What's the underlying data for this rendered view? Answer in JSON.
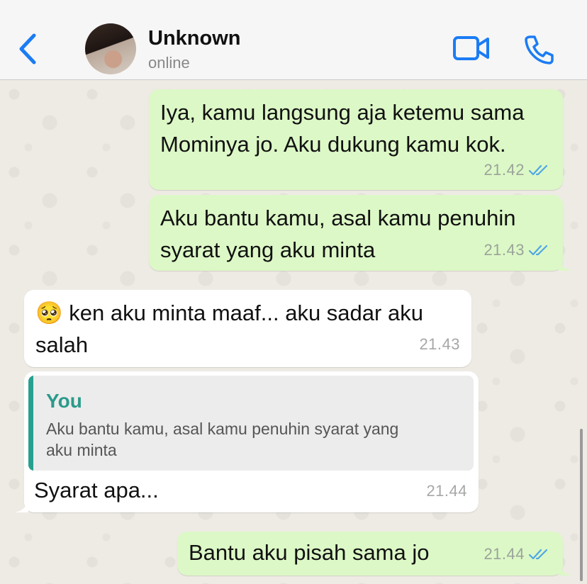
{
  "header": {
    "contact_name": "Unknown",
    "contact_status": "online",
    "back_icon": "chevron-left-icon",
    "video_icon": "video-camera-icon",
    "call_icon": "phone-icon",
    "accent_color": "#1b7cf4"
  },
  "messages": [
    {
      "direction": "outgoing",
      "lines": [
        "Iya, kamu langsung aja ketemu sama",
        "Mominya jo. Aku dukung kamu kok."
      ],
      "time": "21.42",
      "status": "read"
    },
    {
      "direction": "outgoing",
      "lines": [
        "Aku bantu kamu, asal kamu penuhin",
        "syarat yang aku minta"
      ],
      "time": "21.43",
      "status": "read"
    },
    {
      "direction": "incoming",
      "emoji": "🥺",
      "lines": [
        "ken aku minta maaf... aku sadar aku",
        "salah"
      ],
      "time": "21.43"
    },
    {
      "direction": "incoming",
      "quote": {
        "author": "You",
        "lines": [
          "Aku bantu kamu, asal kamu penuhin syarat yang",
          "aku minta"
        ]
      },
      "lines": [
        "Syarat apa..."
      ],
      "time": "21.44"
    },
    {
      "direction": "outgoing",
      "lines": [
        "Bantu aku pisah sama jo"
      ],
      "time": "21.44",
      "status": "read"
    }
  ],
  "colors": {
    "outgoing_bubble": "#dcf8c6",
    "incoming_bubble": "#ffffff",
    "read_ticks": "#4fa7e4",
    "quote_accent": "#28a08f"
  }
}
